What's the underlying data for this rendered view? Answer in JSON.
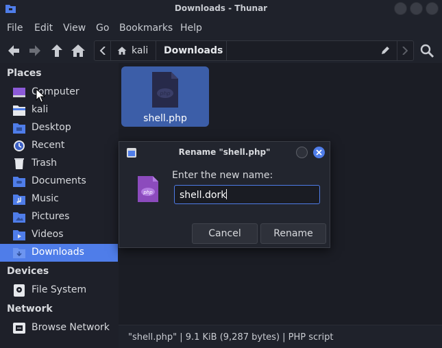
{
  "window": {
    "title": "Downloads - Thunar"
  },
  "menu": [
    "File",
    "Edit",
    "View",
    "Go",
    "Bookmarks",
    "Help"
  ],
  "toolbar": {
    "back_icon": "arrow-left-icon",
    "forward_icon": "arrow-right-icon",
    "up_icon": "arrow-up-icon",
    "home_icon": "home-icon",
    "path": [
      "kali",
      "Downloads"
    ],
    "edit_icon": "pencil-icon",
    "search_icon": "search-icon"
  },
  "sidebar": {
    "places_label": "Places",
    "places": [
      {
        "label": "Computer",
        "icon": "computer-icon"
      },
      {
        "label": "kali",
        "icon": "home-folder-icon"
      },
      {
        "label": "Desktop",
        "icon": "desktop-folder-icon"
      },
      {
        "label": "Recent",
        "icon": "recent-icon"
      },
      {
        "label": "Trash",
        "icon": "trash-icon"
      },
      {
        "label": "Documents",
        "icon": "documents-folder-icon"
      },
      {
        "label": "Music",
        "icon": "music-folder-icon"
      },
      {
        "label": "Pictures",
        "icon": "pictures-folder-icon"
      },
      {
        "label": "Videos",
        "icon": "videos-folder-icon"
      },
      {
        "label": "Downloads",
        "icon": "downloads-folder-icon",
        "active": true
      }
    ],
    "devices_label": "Devices",
    "devices": [
      {
        "label": "File System",
        "icon": "drive-icon"
      }
    ],
    "network_label": "Network",
    "network": [
      {
        "label": "Browse Network",
        "icon": "network-icon"
      }
    ]
  },
  "files": [
    {
      "name": "shell.php",
      "icon": "php-file-icon",
      "selected": true
    }
  ],
  "status": "\"shell.php\" | 9.1 KiB (9,287 bytes) | PHP script",
  "dialog": {
    "title": "Rename \"shell.php\"",
    "prompt": "Enter the new name:",
    "value": "shell.dork",
    "cancel": "Cancel",
    "rename": "Rename"
  },
  "colors": {
    "accent": "#4f7de9",
    "selection": "#3c5ea8",
    "php": "#8c4bbd"
  }
}
